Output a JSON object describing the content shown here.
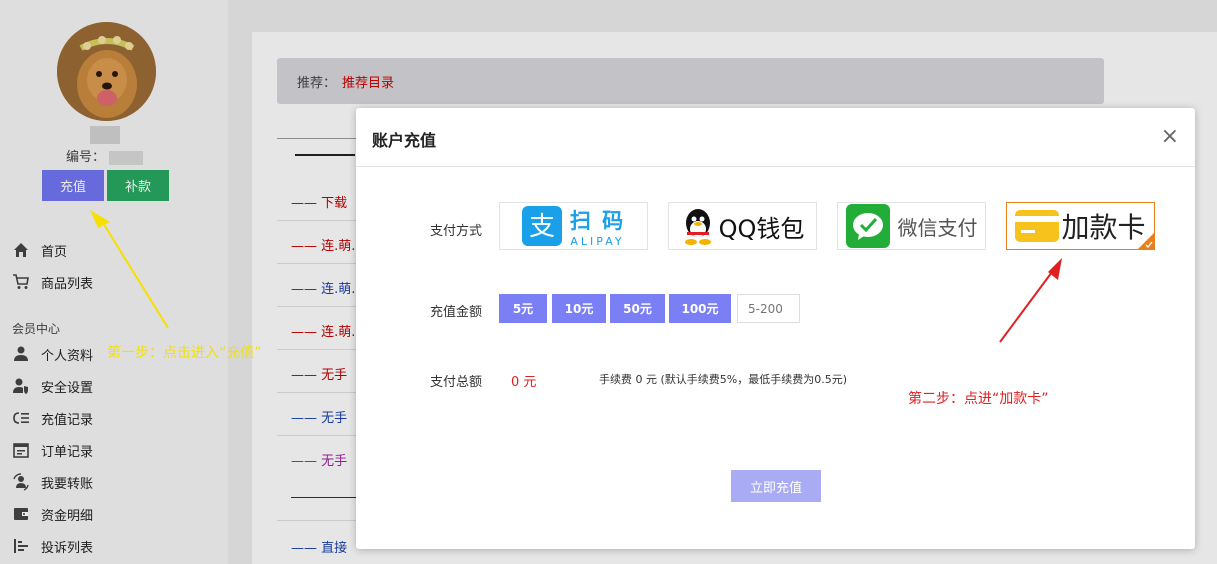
{
  "user": {
    "id_label": "编号："
  },
  "buttons": {
    "charge": "充值",
    "supplement": "补款"
  },
  "nav": {
    "top_items": [
      {
        "label": "首页",
        "icon": "home-icon"
      },
      {
        "label": "商品列表",
        "icon": "cart-icon"
      }
    ],
    "section_title": "会员中心",
    "member_items": [
      {
        "label": "个人资料",
        "icon": "user-icon"
      },
      {
        "label": "安全设置",
        "icon": "user-shield-icon"
      },
      {
        "label": "充值记录",
        "icon": "list-icon"
      },
      {
        "label": "订单记录",
        "icon": "calendar-icon"
      },
      {
        "label": "我要转账",
        "icon": "transfer-icon"
      },
      {
        "label": "资金明细",
        "icon": "wallet-icon"
      },
      {
        "label": "投诉列表",
        "icon": "complaint-icon"
      }
    ]
  },
  "recommend": {
    "label": "推荐：",
    "link": "推荐目录"
  },
  "background_list": [
    {
      "text": "—— 下载",
      "color": "#c00000"
    },
    {
      "text": "—— 连.萌.",
      "color": "#c00000"
    },
    {
      "text": "—— 连.萌.",
      "color": "#1a3fa8"
    },
    {
      "text": "—— 连.萌.",
      "color": "#c00000"
    },
    {
      "text": "—— 无手",
      "color": "#c00000"
    },
    {
      "text": "—— 无手",
      "color": "#1a3fa8"
    },
    {
      "text": "—— 无手",
      "color": "#a020a0"
    },
    {
      "text": "—— 直接",
      "color": "#1a3fa8"
    }
  ],
  "modal": {
    "title": "账户充值",
    "close": "×",
    "pay_method_label": "支付方式",
    "pay_options": [
      {
        "name": "alipay",
        "text": "扫 码",
        "sub": "ALIPAY",
        "icon_char": "支",
        "color": "#1aa0e8"
      },
      {
        "name": "qq",
        "text": "QQ钱包",
        "color": "#111111"
      },
      {
        "name": "wechat",
        "text": "微信支付",
        "color": "#555555"
      },
      {
        "name": "card",
        "text": "加款卡",
        "color": "#222222",
        "selected": true
      }
    ],
    "amount_label": "充值金额",
    "amounts": [
      "5元",
      "10元",
      "50元",
      "100元"
    ],
    "amount_placeholder": "5-200",
    "total_label": "支付总额",
    "total_value": "0 元",
    "fee_note": "手续费 0 元 (默认手续费5%，最低手续费为0.5元)",
    "submit": "立即充值"
  },
  "annotations": {
    "step1": "第一步：点击进入“充值”",
    "step2": "第二步：点进“加款卡”"
  },
  "colors": {
    "accent": "#7b7ff5",
    "charge_button": "#6f73f0",
    "supplement_button": "#27a55f",
    "selected_border": "#e8801e",
    "annotation_yellow": "#f5e000",
    "annotation_red": "#e02020"
  }
}
